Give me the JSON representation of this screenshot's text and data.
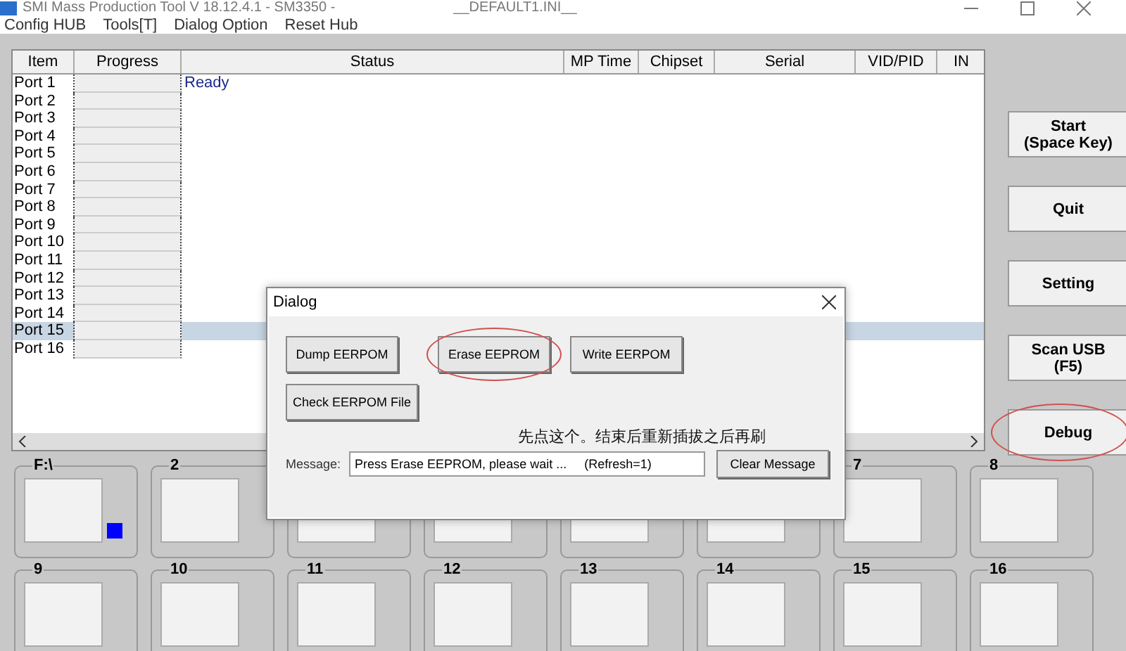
{
  "window": {
    "title": "SMI Mass Production Tool   V 18.12.4.1   - SM3350 -",
    "config_file": "__DEFAULT1.INI__"
  },
  "menu": [
    "Config HUB",
    "Tools[T]",
    "Dialog Option",
    "Reset Hub"
  ],
  "table": {
    "columns": [
      "Item",
      "Progress",
      "Status",
      "MP Time",
      "Chipset",
      "Serial",
      "VID/PID",
      "IN"
    ],
    "rows": [
      {
        "item": "Port 1",
        "status": "Ready",
        "selected": false
      },
      {
        "item": "Port 2",
        "selected": false
      },
      {
        "item": "Port 3",
        "selected": false
      },
      {
        "item": "Port 4",
        "selected": false
      },
      {
        "item": "Port 5",
        "selected": false
      },
      {
        "item": "Port 6",
        "selected": false
      },
      {
        "item": "Port 7",
        "selected": false
      },
      {
        "item": "Port 8",
        "selected": false
      },
      {
        "item": "Port 9",
        "selected": false
      },
      {
        "item": "Port 10",
        "selected": false
      },
      {
        "item": "Port 11",
        "selected": false
      },
      {
        "item": "Port 12",
        "selected": false
      },
      {
        "item": "Port 13",
        "selected": false
      },
      {
        "item": "Port 14",
        "selected": false
      },
      {
        "item": "Port 15",
        "selected": true
      },
      {
        "item": "Port 16",
        "selected": false
      }
    ]
  },
  "side_buttons": [
    {
      "label": "Start\n(Space Key)",
      "circled": false
    },
    {
      "label": "Quit",
      "circled": false
    },
    {
      "label": "Setting",
      "circled": false
    },
    {
      "label": "Scan USB\n(F5)",
      "circled": false
    },
    {
      "label": "Debug",
      "circled": true
    }
  ],
  "slots": [
    {
      "label": "F:\\",
      "active": true
    },
    {
      "label": "2",
      "active": false
    },
    {
      "active": false
    },
    {
      "active": false
    },
    {
      "active": false
    },
    {
      "active": false
    },
    {
      "label": "7",
      "active": false
    },
    {
      "label": "8",
      "active": false
    },
    {
      "label": "9",
      "active": false
    },
    {
      "label": "10",
      "active": false
    },
    {
      "label": "11",
      "active": false
    },
    {
      "label": "12",
      "active": false
    },
    {
      "label": "13",
      "active": false
    },
    {
      "label": "14",
      "active": false
    },
    {
      "label": "15",
      "active": false
    },
    {
      "label": "16",
      "active": false
    }
  ],
  "dialog": {
    "title": "Dialog",
    "buttons": [
      {
        "label": "Dump EERPOM",
        "circled": false
      },
      {
        "label": "Erase EEPROM",
        "circled": true
      },
      {
        "label": "Write EERPOM",
        "circled": false
      },
      {
        "label": "Check EERPOM File",
        "circled": false
      }
    ],
    "note": "先点这个。结束后重新插拔之后再刷",
    "message_label": "Message:",
    "message": "Press Erase EEPROM, please wait ...     (Refresh=1)",
    "clear_button": "Clear Message"
  }
}
